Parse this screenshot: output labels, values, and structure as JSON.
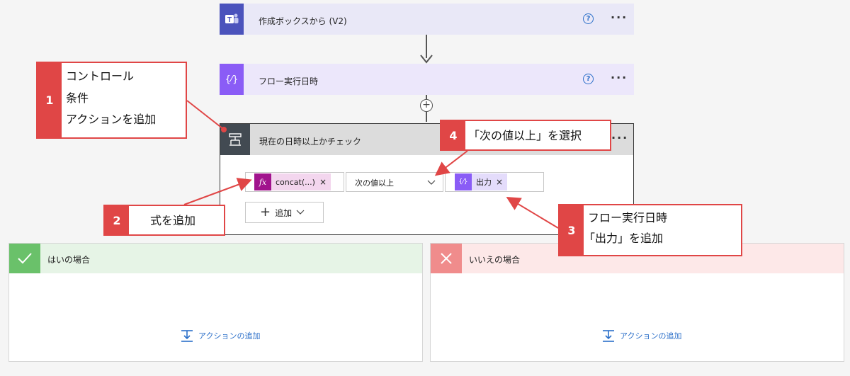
{
  "cards": {
    "teams": {
      "title": "作成ボックスから (V2)",
      "icon": "teams-icon",
      "color": "#4b53bc",
      "bg": "#e9e8f7"
    },
    "flow_time": {
      "title": "フロー実行日時",
      "icon": "expression-icon",
      "icon_text": "{⁄}",
      "color": "#8a5cf6",
      "bg": "#ece7fb"
    },
    "condition": {
      "title": "現在の日時以上かチェック",
      "icon": "condition-icon",
      "color": "#424a52",
      "bg": "#dcdcdc"
    }
  },
  "condition_row": {
    "left_token": {
      "icon": "fx-icon",
      "icon_text": "fx",
      "label": "concat(...)",
      "remove": "×",
      "color": "#a1138d",
      "bg": "#f3d6ee"
    },
    "operator": {
      "label": "次の値以上",
      "chevron": "chevron-down-icon"
    },
    "right_token": {
      "icon": "expression-icon",
      "icon_text": "{⁄}",
      "label": "出力",
      "remove": "×",
      "color": "#8a5cf6",
      "bg": "#e4dcfb"
    }
  },
  "add_button": {
    "plus": "+",
    "label": "追加"
  },
  "plus_connector": "+",
  "branches": {
    "yes": {
      "title": "はいの場合",
      "color": "#6ac16a",
      "bg": "#e6f4e6",
      "add_action": "アクションの追加"
    },
    "no": {
      "title": "いいえの場合",
      "color": "#f08c8c",
      "bg": "#fde8e8",
      "add_action": "アクションの追加"
    }
  },
  "callouts": [
    {
      "num": "1",
      "lines": [
        "コントロール",
        "条件",
        "アクションを追加"
      ]
    },
    {
      "num": "2",
      "lines": [
        "式を追加"
      ]
    },
    {
      "num": "3",
      "lines": [
        "フロー実行日時",
        "「出力」を追加"
      ]
    },
    {
      "num": "4",
      "lines": [
        "「次の値以上」を選択"
      ]
    }
  ],
  "help_glyph": "?",
  "more_glyph": "···",
  "accent": "#e04646"
}
